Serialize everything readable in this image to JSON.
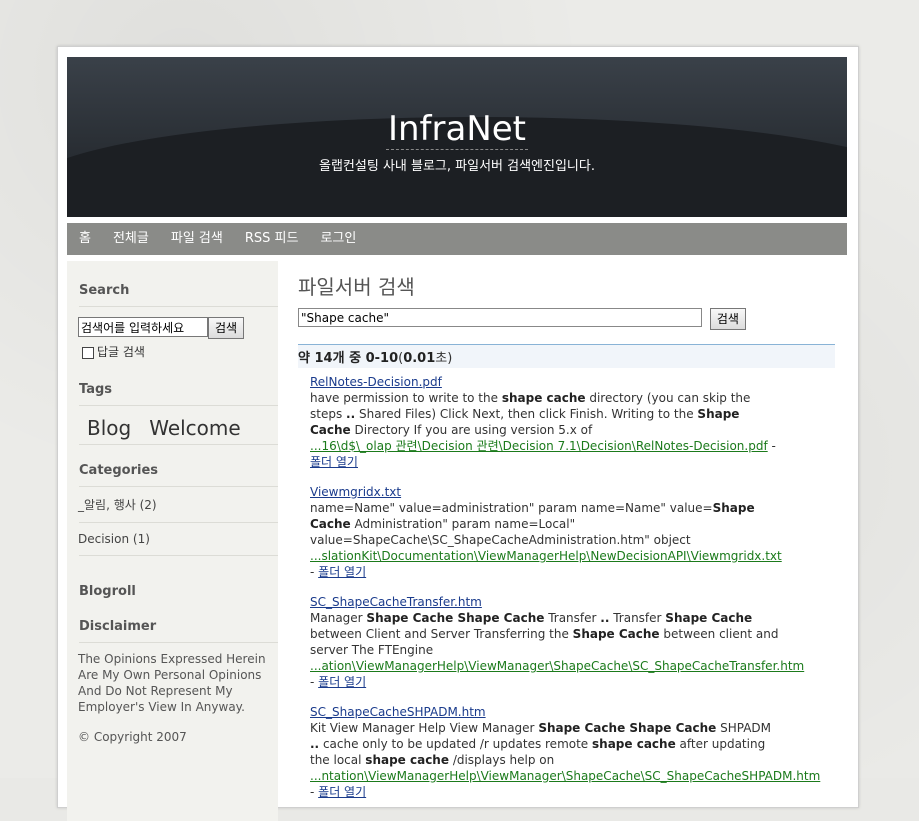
{
  "header": {
    "title": "InfraNet",
    "subtitle": "올랩컨설팅 사내 블로그, 파일서버 검색엔진입니다."
  },
  "nav": {
    "items": [
      "홈",
      "전체글",
      "파일 검색",
      "RSS 피드",
      "로그인"
    ]
  },
  "sidebar": {
    "search_heading": "Search",
    "search_placeholder": "검색어를 입력하세요",
    "search_button": "검색",
    "reply_search_label": "답글 검색",
    "tags_heading": "Tags",
    "tags": [
      "Blog",
      "Welcome"
    ],
    "categories_heading": "Categories",
    "categories": [
      "_알림, 행사 (2)",
      "Decision (1)"
    ],
    "blogroll_heading": "Blogroll",
    "disclaimer_heading": "Disclaimer",
    "disclaimer_text": "The Opinions Expressed Herein Are My Own Personal Opinions And Do Not Represent My Employer's View In Anyway.",
    "copyright": "© Copyright 2007"
  },
  "main": {
    "heading": "파일서버 검색",
    "query_value": "\"Shape cache\"",
    "search_button": "검색",
    "count_prefix": "약 ",
    "count_total": "14",
    "count_mid": "개 중 ",
    "count_range": "0-10",
    "count_time_open": "(",
    "count_time": "0.01",
    "count_time_close": "초)",
    "results": [
      {
        "title": "RelNotes-Decision.pdf",
        "path": "...16\\d$\\_olap 관련\\Decision 관련\\Decision 7.1\\Decision\\RelNotes-Decision.pdf",
        "open_label": "폴더 열기"
      },
      {
        "title": "Viewmgridx.txt",
        "path": "...slationKit\\Documentation\\ViewManagerHelp\\NewDecisionAPI\\Viewmgridx.txt",
        "open_label": "폴더 열기"
      },
      {
        "title": "SC_ShapeCacheTransfer.htm",
        "path": "...ation\\ViewManagerHelp\\ViewManager\\ShapeCache\\SC_ShapeCacheTransfer.htm",
        "open_label": "폴더 열기"
      },
      {
        "title": "SC_ShapeCacheSHPADM.htm",
        "path": "...ntation\\ViewManagerHelp\\ViewManager\\ShapeCache\\SC_ShapeCacheSHPADM.htm",
        "open_label": "폴더 열기"
      }
    ]
  }
}
